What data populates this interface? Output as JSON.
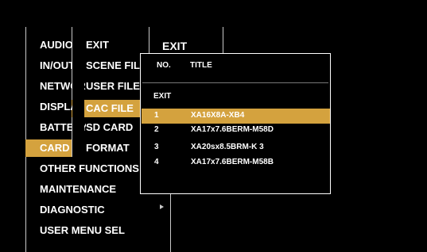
{
  "colors": {
    "background": "#000000",
    "text": "#ffffff",
    "highlight": "#d4a23e",
    "divider": "#c8c8c8"
  },
  "menu_level1": {
    "items": [
      {
        "label": "AUDIO"
      },
      {
        "label": "IN/OUT"
      },
      {
        "label": "NETWORK"
      },
      {
        "label": "DISPLAY"
      },
      {
        "label": "BATTERY"
      },
      {
        "label": "CARD"
      },
      {
        "label": "OTHER FUNCTIONS"
      },
      {
        "label": "MAINTENANCE"
      },
      {
        "label": "DIAGNOSTIC"
      },
      {
        "label": "USER MENU SEL"
      }
    ],
    "selected": "CARD"
  },
  "menu_level2": {
    "items": [
      {
        "label": "EXIT"
      },
      {
        "label": "SCENE FILE"
      },
      {
        "label": "USER FILE"
      },
      {
        "label": "CAC FILE"
      },
      {
        "label": "SD CARD"
      },
      {
        "label": "FORMAT"
      }
    ],
    "selected": "CAC FILE"
  },
  "menu_level3": {
    "label": "EXIT"
  },
  "popup": {
    "header": {
      "no": "NO.",
      "title": "TITLE"
    },
    "exit_label": "EXIT",
    "rows": [
      {
        "no": "1",
        "title": "XA16X8A-XB4"
      },
      {
        "no": "2",
        "title": "XA17x7.6BERM-M58D"
      },
      {
        "no": "3",
        "title": "XA20sx8.5BRM-K 3"
      },
      {
        "no": "4",
        "title": "XA17x7.6BERM-M58B"
      }
    ],
    "selected_row": 0
  },
  "submenu_arrow_icon": "right-triangle-icon"
}
